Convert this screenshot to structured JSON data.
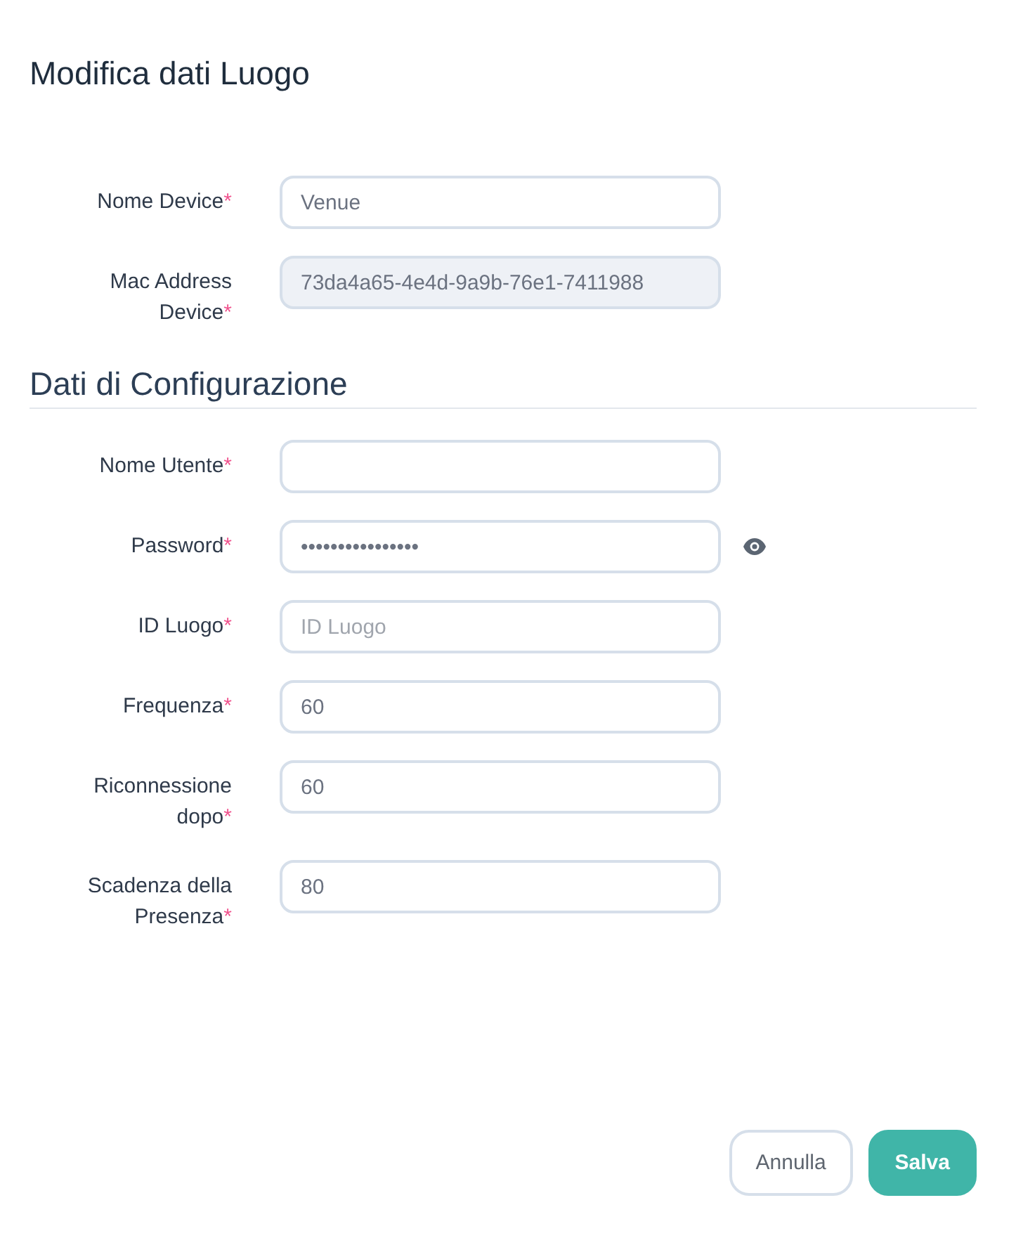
{
  "title": "Modifica dati Luogo",
  "device_fields": [
    {
      "label": "Nome Device",
      "required_mark": "*",
      "value": "Venue",
      "disabled": false
    },
    {
      "label": "Mac Address Device",
      "required_mark": "*",
      "value": "73da4a65-4e4d-9a9b-76e1-7411988",
      "disabled": true
    }
  ],
  "section_title": "Dati di Configurazione",
  "config_fields": [
    {
      "label": "Nome Utente",
      "required_mark": "*",
      "kind": "text",
      "disabled": false
    },
    {
      "label": "Password",
      "required_mark": "*",
      "kind": "password",
      "value": "••••••••••••••••",
      "disabled": false
    },
    {
      "label": "ID Luogo",
      "required_mark": "*",
      "kind": "text",
      "placeholder": "ID Luogo",
      "disabled": false
    },
    {
      "label": "Frequenza",
      "required_mark": "*",
      "kind": "text",
      "value": "60",
      "disabled": false
    },
    {
      "label": "Riconnessione dopo",
      "required_mark": "*",
      "kind": "text",
      "value": "60",
      "disabled": false
    },
    {
      "label": "Scadenza della Presenza",
      "required_mark": "*",
      "kind": "text",
      "value": "80",
      "disabled": false
    }
  ],
  "buttons": [
    {
      "label": "Annulla",
      "kind": "secondary"
    },
    {
      "label": "Salva",
      "kind": "primary"
    }
  ]
}
